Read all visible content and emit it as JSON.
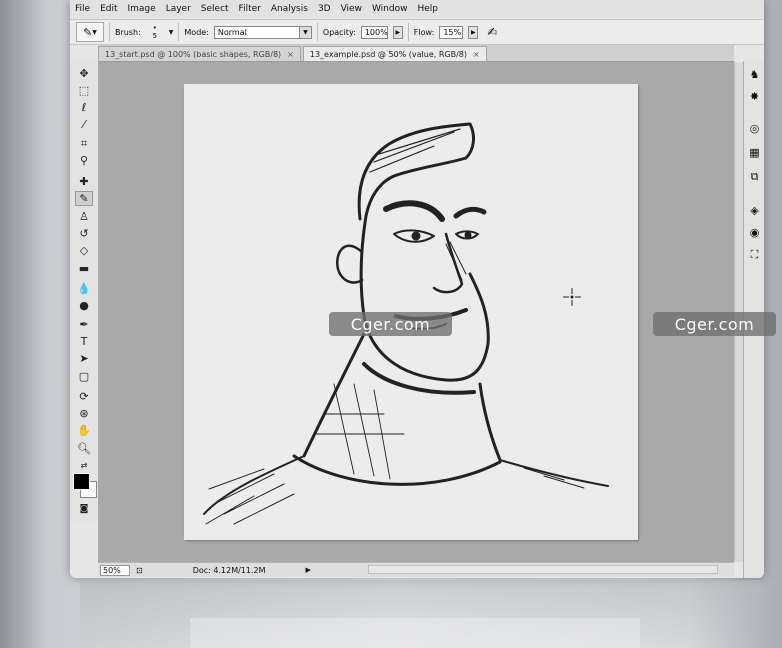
{
  "menu": [
    "File",
    "Edit",
    "Image",
    "Layer",
    "Select",
    "Filter",
    "Analysis",
    "3D",
    "View",
    "Window",
    "Help"
  ],
  "options": {
    "brush_label": "Brush:",
    "brush_size": "5",
    "mode_label": "Mode:",
    "mode_value": "Normal",
    "opacity_label": "Opacity:",
    "opacity_value": "100%",
    "flow_label": "Flow:",
    "flow_value": "15%"
  },
  "tabs": [
    {
      "label": "13_start.psd @ 100% (basic shapes, RGB/8)",
      "active": false
    },
    {
      "label": "13_example.psd @ 50% (value, RGB/8)",
      "active": true
    }
  ],
  "tools": [
    "move-tool-icon",
    "marquee-tool-icon",
    "lasso-tool-icon",
    "quick-selection-tool-icon",
    "crop-tool-icon",
    "eyedropper-tool-icon",
    "healing-brush-tool-icon",
    "brush-tool-icon",
    "clone-stamp-tool-icon",
    "history-brush-tool-icon",
    "eraser-tool-icon",
    "gradient-tool-icon",
    "blur-tool-icon",
    "dodge-tool-icon",
    "pen-tool-icon",
    "type-tool-icon",
    "path-selection-tool-icon",
    "shape-tool-icon",
    "3d-rotate-tool-icon",
    "3d-orbit-tool-icon",
    "hand-tool-icon",
    "zoom-tool-icon"
  ],
  "colors": {
    "foreground": "#000000",
    "background": "#ffffff"
  },
  "status": {
    "zoom": "50%",
    "doc": "Doc: 4.12M/11.2M"
  },
  "watermark": "Cger.com"
}
